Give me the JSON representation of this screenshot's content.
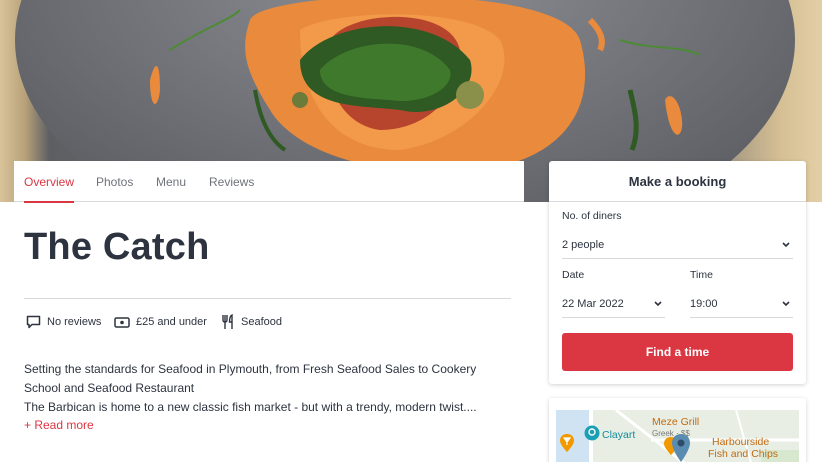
{
  "tabs": [
    {
      "label": "Overview",
      "active": true
    },
    {
      "label": "Photos",
      "active": false
    },
    {
      "label": "Menu",
      "active": false
    },
    {
      "label": "Reviews",
      "active": false
    }
  ],
  "restaurant": {
    "name": "The Catch",
    "meta": {
      "reviews": "No reviews",
      "price": "£25 and under",
      "cuisine": "Seafood"
    },
    "description_line1": "Setting the standards for Seafood in Plymouth, from Fresh Seafood Sales to Cookery School and Seafood Restaurant",
    "description_line2": "The Barbican is home to a new classic fish market - but with a trendy, modern twist....",
    "read_more": "+ Read more"
  },
  "booking": {
    "title": "Make a booking",
    "diners_label": "No. of diners",
    "diners_value": "2 people",
    "date_label": "Date",
    "date_value": "22 Mar 2022",
    "time_label": "Time",
    "time_value": "19:00",
    "button": "Find a time"
  },
  "map": {
    "labels": [
      "Clayart",
      "Meze Grill",
      "Greek · $$",
      "Harbourside",
      "Fish and Chips"
    ]
  },
  "colors": {
    "accent": "#da3743",
    "text": "#2d333f",
    "muted": "#6f737b",
    "border": "#d8d9db"
  }
}
